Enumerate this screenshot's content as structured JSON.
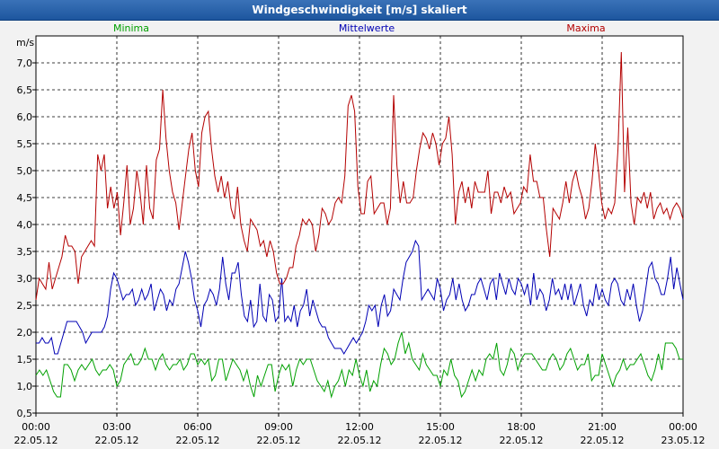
{
  "window": {
    "title": "Windgeschwindigkeit [m/s] skaliert"
  },
  "chart_data": {
    "type": "line",
    "title": "Windgeschwindigkeit [m/s] skaliert",
    "ylabel": "m/s",
    "ylim": [
      0.5,
      7.5
    ],
    "yticks": [
      "0,5",
      "1,0",
      "1,5",
      "2,0",
      "2,5",
      "3,0",
      "3,5",
      "4,0",
      "4,5",
      "5,0",
      "5,5",
      "6,0",
      "6,5",
      "7,0"
    ],
    "xticks": [
      {
        "time": "00:00",
        "date": "22.05.12"
      },
      {
        "time": "03:00",
        "date": "22.05.12"
      },
      {
        "time": "06:00",
        "date": "22.05.12"
      },
      {
        "time": "09:00",
        "date": "22.05.12"
      },
      {
        "time": "12:00",
        "date": "22.05.12"
      },
      {
        "time": "15:00",
        "date": "22.05.12"
      },
      {
        "time": "18:00",
        "date": "22.05.12"
      },
      {
        "time": "21:00",
        "date": "22.05.12"
      },
      {
        "time": "00:00",
        "date": "23.05.12"
      }
    ],
    "grid": true,
    "legend": "top",
    "colors": {
      "Minima": "#00a000",
      "Mittelwerte": "#0000b4",
      "Maxima": "#b40000"
    },
    "series": [
      {
        "name": "Minima",
        "values": [
          1.2,
          1.3,
          1.2,
          1.3,
          1.1,
          0.9,
          0.8,
          0.8,
          1.4,
          1.4,
          1.3,
          1.1,
          1.3,
          1.4,
          1.3,
          1.4,
          1.5,
          1.3,
          1.2,
          1.3,
          1.3,
          1.4,
          1.3,
          1.0,
          1.1,
          1.4,
          1.5,
          1.6,
          1.4,
          1.4,
          1.5,
          1.7,
          1.5,
          1.5,
          1.3,
          1.5,
          1.6,
          1.4,
          1.3,
          1.4,
          1.4,
          1.5,
          1.3,
          1.4,
          1.6,
          1.6,
          1.4,
          1.5,
          1.4,
          1.5,
          1.1,
          1.2,
          1.5,
          1.5,
          1.1,
          1.3,
          1.5,
          1.4,
          1.3,
          1.1,
          1.3,
          1.0,
          0.8,
          1.2,
          1.0,
          1.2,
          1.4,
          1.4,
          0.9,
          1.2,
          1.4,
          1.3,
          1.4,
          1.0,
          1.3,
          1.5,
          1.4,
          1.5,
          1.5,
          1.3,
          1.1,
          1.0,
          0.9,
          1.1,
          0.8,
          1.0,
          1.1,
          1.3,
          1.0,
          1.3,
          1.2,
          1.5,
          1.2,
          1.0,
          1.3,
          0.9,
          1.1,
          1.0,
          1.4,
          1.7,
          1.6,
          1.4,
          1.5,
          1.8,
          2.0,
          1.6,
          1.8,
          1.5,
          1.4,
          1.3,
          1.6,
          1.4,
          1.3,
          1.2,
          1.2,
          1.0,
          1.3,
          1.2,
          1.5,
          1.2,
          1.1,
          0.8,
          0.9,
          1.1,
          1.3,
          1.1,
          1.3,
          1.2,
          1.5,
          1.6,
          1.5,
          1.8,
          1.3,
          1.2,
          1.4,
          1.7,
          1.6,
          1.3,
          1.5,
          1.6,
          1.6,
          1.6,
          1.5,
          1.4,
          1.3,
          1.3,
          1.5,
          1.6,
          1.5,
          1.3,
          1.4,
          1.6,
          1.7,
          1.5,
          1.3,
          1.4,
          1.4,
          1.6,
          1.1,
          1.2,
          1.2,
          1.6,
          1.4,
          1.2,
          1.0,
          1.2,
          1.3,
          1.5,
          1.3,
          1.4,
          1.4,
          1.5,
          1.6,
          1.4,
          1.2,
          1.1,
          1.3,
          1.6,
          1.3,
          1.8,
          1.8,
          1.8,
          1.7,
          1.5,
          1.5
        ]
      },
      {
        "name": "Mittelwerte",
        "values": [
          1.8,
          1.8,
          1.9,
          1.8,
          1.8,
          1.9,
          1.6,
          1.6,
          1.8,
          2.0,
          2.2,
          2.2,
          2.2,
          2.2,
          2.1,
          2.0,
          1.8,
          1.9,
          2.0,
          2.0,
          2.0,
          2.0,
          2.1,
          2.3,
          2.8,
          3.1,
          3.0,
          2.8,
          2.6,
          2.7,
          2.7,
          2.8,
          2.5,
          2.6,
          2.8,
          2.6,
          2.7,
          2.9,
          2.4,
          2.6,
          2.8,
          2.7,
          2.4,
          2.6,
          2.5,
          2.8,
          2.9,
          3.2,
          3.5,
          3.3,
          3.0,
          2.6,
          2.4,
          2.1,
          2.5,
          2.6,
          2.8,
          2.7,
          2.5,
          2.8,
          3.4,
          2.9,
          2.6,
          3.1,
          3.1,
          3.3,
          2.7,
          2.3,
          2.2,
          2.6,
          2.1,
          2.2,
          2.9,
          2.3,
          2.2,
          2.7,
          2.6,
          2.2,
          2.3,
          3.0,
          2.2,
          2.3,
          2.2,
          2.5,
          2.1,
          2.4,
          2.5,
          2.8,
          2.3,
          2.6,
          2.4,
          2.2,
          2.1,
          2.1,
          1.9,
          1.8,
          1.7,
          1.7,
          1.7,
          1.6,
          1.7,
          1.8,
          1.9,
          1.8,
          1.9,
          2.0,
          2.2,
          2.5,
          2.4,
          2.5,
          2.1,
          2.5,
          2.7,
          2.3,
          2.4,
          2.8,
          2.7,
          2.6,
          3.0,
          3.3,
          3.4,
          3.5,
          3.7,
          3.6,
          2.6,
          2.7,
          2.8,
          2.7,
          2.6,
          3.0,
          2.8,
          2.4,
          2.6,
          2.7,
          3.0,
          2.6,
          2.9,
          2.6,
          2.4,
          2.5,
          2.7,
          2.7,
          2.9,
          3.0,
          2.8,
          2.6,
          2.9,
          3.0,
          2.6,
          3.1,
          2.9,
          2.7,
          3.0,
          2.8,
          2.7,
          3.0,
          2.9,
          2.7,
          2.9,
          2.5,
          3.1,
          2.6,
          2.8,
          2.7,
          2.4,
          2.6,
          3.0,
          2.7,
          2.8,
          2.6,
          2.9,
          2.6,
          2.9,
          2.5,
          2.7,
          2.9,
          2.5,
          2.3,
          2.6,
          2.5,
          2.9,
          2.6,
          2.8,
          2.6,
          2.5,
          2.9,
          3.0,
          2.9,
          2.6,
          2.5,
          2.8,
          2.6,
          2.9,
          2.5,
          2.2,
          2.4,
          2.8,
          3.2,
          3.3,
          3.0,
          2.9,
          2.7,
          2.7,
          3.0,
          3.4,
          2.8,
          3.2,
          2.9,
          2.6
        ]
      },
      {
        "name": "Maxima",
        "values": [
          2.6,
          3.0,
          2.9,
          2.8,
          3.3,
          2.8,
          3.0,
          3.2,
          3.4,
          3.8,
          3.6,
          3.6,
          3.5,
          2.9,
          3.4,
          3.5,
          3.6,
          3.7,
          3.6,
          5.3,
          5.0,
          5.3,
          4.3,
          4.7,
          4.3,
          4.6,
          3.8,
          4.4,
          5.1,
          4.0,
          4.3,
          5.0,
          4.6,
          4.0,
          5.1,
          4.3,
          4.1,
          5.2,
          5.4,
          6.5,
          5.6,
          5.0,
          4.6,
          4.4,
          3.9,
          4.4,
          4.9,
          5.4,
          5.7,
          5.0,
          4.7,
          5.7,
          6.0,
          6.1,
          5.4,
          4.9,
          4.6,
          4.9,
          4.5,
          4.8,
          4.3,
          4.1,
          4.7,
          4.0,
          3.7,
          3.5,
          4.1,
          4.0,
          3.9,
          3.6,
          3.7,
          3.4,
          3.7,
          3.5,
          3.1,
          2.9,
          2.9,
          3.0,
          3.2,
          3.2,
          3.6,
          3.8,
          4.1,
          4.0,
          4.1,
          4.0,
          3.5,
          3.8,
          4.3,
          4.2,
          4.0,
          4.1,
          4.4,
          4.5,
          4.4,
          4.9,
          6.2,
          6.4,
          6.1,
          4.7,
          4.2,
          4.2,
          4.8,
          4.9,
          4.2,
          4.3,
          4.4,
          4.4,
          4.0,
          4.3,
          6.4,
          5.1,
          4.4,
          4.8,
          4.4,
          4.4,
          4.5,
          5.0,
          5.4,
          5.7,
          5.6,
          5.4,
          5.7,
          5.5,
          5.1,
          5.5,
          5.6,
          6.0,
          5.3,
          4.0,
          4.6,
          4.8,
          4.4,
          4.7,
          4.3,
          4.8,
          4.6,
          4.6,
          4.6,
          5.0,
          4.2,
          4.6,
          4.6,
          4.4,
          4.7,
          4.5,
          4.6,
          4.2,
          4.3,
          4.4,
          4.7,
          4.6,
          5.3,
          4.8,
          4.8,
          4.5,
          4.5,
          3.9,
          3.4,
          4.3,
          4.2,
          4.1,
          4.4,
          4.8,
          4.4,
          4.8,
          5.0,
          4.7,
          4.5,
          4.1,
          4.3,
          4.8,
          5.5,
          5.0,
          4.4,
          4.1,
          4.3,
          4.2,
          4.4,
          5.4,
          7.2,
          4.6,
          5.8,
          4.4,
          4.0,
          4.5,
          4.4,
          4.6,
          4.3,
          4.6,
          4.1,
          4.3,
          4.4,
          4.2,
          4.3,
          4.1,
          4.3,
          4.4,
          4.3,
          4.1
        ]
      }
    ]
  }
}
